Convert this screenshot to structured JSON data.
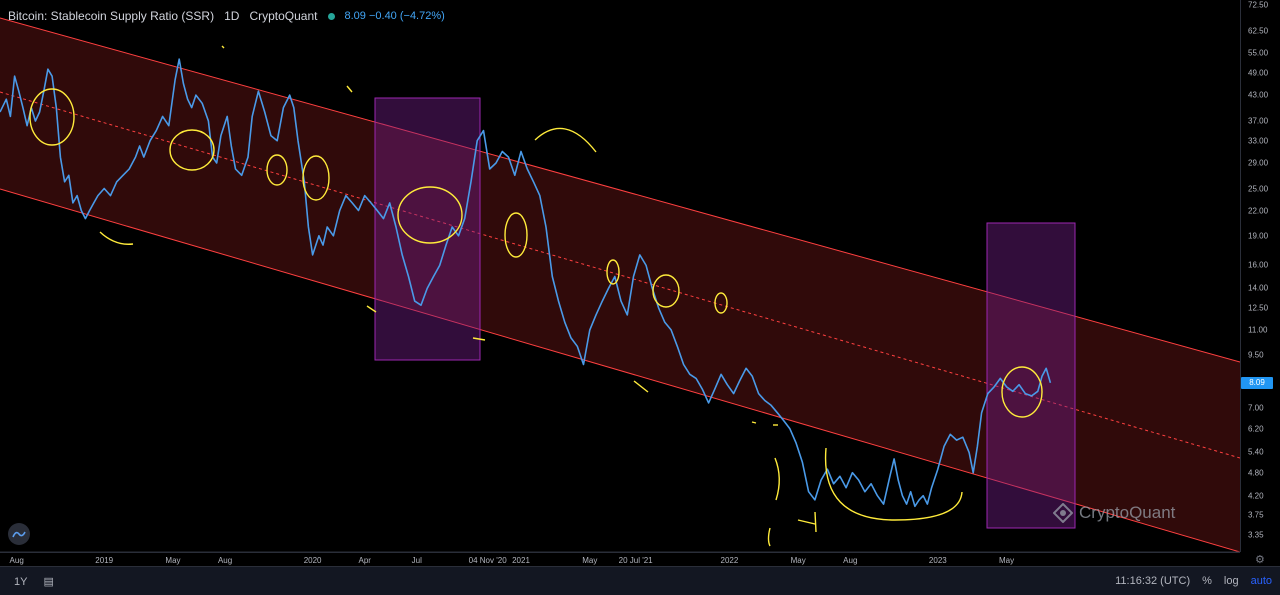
{
  "header": {
    "title": "Bitcoin: Stablecoin Supply Ratio (SSR)",
    "interval": "1D",
    "source": "CryptoQuant",
    "value_text": "8.09 −0.40 (−4.72%)"
  },
  "watermark": "CryptoQuant",
  "bottombar": {
    "range": "1Y",
    "time": "11:16:32 (UTC)",
    "percent": "%",
    "log": "log",
    "auto": "auto"
  },
  "colors": {
    "line": "#4a9ae8",
    "channel": "#ff4444",
    "box": "#9c27b0",
    "annotation": "#ffeb3b",
    "badge": "#2196f3"
  },
  "chart_data": {
    "type": "line",
    "title": "Bitcoin: Stablecoin Supply Ratio (SSR)",
    "scale": "log",
    "ylim": [
      3.1,
      73
    ],
    "last_value": "8.09",
    "y_ticks": [
      "72.50",
      "62.50",
      "55.00",
      "49.00",
      "43.00",
      "37.00",
      "33.00",
      "29.00",
      "25.00",
      "22.00",
      "19.00",
      "16.00",
      "14.00",
      "12.50",
      "11.00",
      "9.50",
      "7.00",
      "6.20",
      "5.40",
      "4.80",
      "4.20",
      "3.75",
      "3.35"
    ],
    "x_ticks": [
      {
        "label": "Aug",
        "t": 2018.58
      },
      {
        "label": "2019",
        "t": 2019.0
      },
      {
        "label": "May",
        "t": 2019.33
      },
      {
        "label": "Aug",
        "t": 2019.58
      },
      {
        "label": "2020",
        "t": 2020.0
      },
      {
        "label": "Apr",
        "t": 2020.25
      },
      {
        "label": "Jul",
        "t": 2020.5
      },
      {
        "label": "04 Nov '20",
        "t": 2020.84
      },
      {
        "label": "2021",
        "t": 2021.0
      },
      {
        "label": "May",
        "t": 2021.33
      },
      {
        "label": "20 Jul '21",
        "t": 2021.55
      },
      {
        "label": "2022",
        "t": 2022.0
      },
      {
        "label": "May",
        "t": 2022.33
      },
      {
        "label": "Aug",
        "t": 2022.58
      },
      {
        "label": "2023",
        "t": 2023.0
      },
      {
        "label": "May",
        "t": 2023.33
      }
    ],
    "x_range": [
      2018.5,
      2024.45
    ],
    "series": [
      {
        "points": [
          [
            2018.5,
            39
          ],
          [
            2018.53,
            42
          ],
          [
            2018.55,
            38
          ],
          [
            2018.57,
            48
          ],
          [
            2018.59,
            44
          ],
          [
            2018.61,
            40
          ],
          [
            2018.63,
            36
          ],
          [
            2018.65,
            40
          ],
          [
            2018.67,
            37
          ],
          [
            2018.69,
            39
          ],
          [
            2018.71,
            44
          ],
          [
            2018.73,
            50
          ],
          [
            2018.75,
            48
          ],
          [
            2018.77,
            40
          ],
          [
            2018.79,
            30
          ],
          [
            2018.81,
            26
          ],
          [
            2018.83,
            27
          ],
          [
            2018.85,
            23
          ],
          [
            2018.87,
            24
          ],
          [
            2018.89,
            22
          ],
          [
            2018.91,
            21
          ],
          [
            2018.93,
            22
          ],
          [
            2018.95,
            23
          ],
          [
            2018.97,
            24
          ],
          [
            2019.0,
            25
          ],
          [
            2019.03,
            24
          ],
          [
            2019.06,
            26
          ],
          [
            2019.09,
            27
          ],
          [
            2019.12,
            28
          ],
          [
            2019.15,
            30
          ],
          [
            2019.17,
            32
          ],
          [
            2019.19,
            30
          ],
          [
            2019.22,
            33
          ],
          [
            2019.25,
            35
          ],
          [
            2019.28,
            38
          ],
          [
            2019.31,
            36
          ],
          [
            2019.34,
            47
          ],
          [
            2019.36,
            53
          ],
          [
            2019.38,
            46
          ],
          [
            2019.4,
            42
          ],
          [
            2019.42,
            40
          ],
          [
            2019.44,
            43
          ],
          [
            2019.47,
            41
          ],
          [
            2019.5,
            37
          ],
          [
            2019.52,
            30
          ],
          [
            2019.54,
            29
          ],
          [
            2019.56,
            34
          ],
          [
            2019.59,
            38
          ],
          [
            2019.61,
            32
          ],
          [
            2019.63,
            28
          ],
          [
            2019.66,
            27
          ],
          [
            2019.69,
            30
          ],
          [
            2019.71,
            38
          ],
          [
            2019.74,
            44
          ],
          [
            2019.77,
            39
          ],
          [
            2019.8,
            34
          ],
          [
            2019.83,
            33
          ],
          [
            2019.86,
            40
          ],
          [
            2019.89,
            43
          ],
          [
            2019.91,
            40
          ],
          [
            2019.93,
            33
          ],
          [
            2019.96,
            26
          ],
          [
            2019.98,
            20
          ],
          [
            2020.0,
            17
          ],
          [
            2020.03,
            19
          ],
          [
            2020.05,
            18
          ],
          [
            2020.07,
            20
          ],
          [
            2020.1,
            19
          ],
          [
            2020.13,
            22
          ],
          [
            2020.16,
            24
          ],
          [
            2020.19,
            23
          ],
          [
            2020.22,
            22
          ],
          [
            2020.25,
            24
          ],
          [
            2020.28,
            23
          ],
          [
            2020.31,
            22
          ],
          [
            2020.34,
            21
          ],
          [
            2020.37,
            23
          ],
          [
            2020.4,
            20
          ],
          [
            2020.43,
            17
          ],
          [
            2020.46,
            15
          ],
          [
            2020.49,
            13
          ],
          [
            2020.52,
            12.7
          ],
          [
            2020.55,
            14
          ],
          [
            2020.58,
            15
          ],
          [
            2020.61,
            16
          ],
          [
            2020.64,
            18
          ],
          [
            2020.67,
            20
          ],
          [
            2020.7,
            19
          ],
          [
            2020.73,
            21
          ],
          [
            2020.76,
            26
          ],
          [
            2020.79,
            33
          ],
          [
            2020.82,
            35
          ],
          [
            2020.85,
            28
          ],
          [
            2020.88,
            29
          ],
          [
            2020.91,
            31
          ],
          [
            2020.94,
            30
          ],
          [
            2020.97,
            27
          ],
          [
            2021.0,
            31
          ],
          [
            2021.03,
            28
          ],
          [
            2021.06,
            26
          ],
          [
            2021.09,
            24
          ],
          [
            2021.12,
            20
          ],
          [
            2021.15,
            15
          ],
          [
            2021.18,
            13
          ],
          [
            2021.21,
            11.5
          ],
          [
            2021.24,
            10.5
          ],
          [
            2021.27,
            10
          ],
          [
            2021.3,
            9
          ],
          [
            2021.33,
            11
          ],
          [
            2021.36,
            12
          ],
          [
            2021.39,
            13
          ],
          [
            2021.42,
            14
          ],
          [
            2021.45,
            15
          ],
          [
            2021.48,
            13
          ],
          [
            2021.51,
            12
          ],
          [
            2021.54,
            15
          ],
          [
            2021.57,
            17
          ],
          [
            2021.6,
            16
          ],
          [
            2021.63,
            14
          ],
          [
            2021.66,
            12.5
          ],
          [
            2021.69,
            11.5
          ],
          [
            2021.72,
            11
          ],
          [
            2021.75,
            10
          ],
          [
            2021.78,
            9
          ],
          [
            2021.81,
            8.5
          ],
          [
            2021.84,
            8.3
          ],
          [
            2021.87,
            7.8
          ],
          [
            2021.9,
            7.2
          ],
          [
            2021.93,
            7.8
          ],
          [
            2021.96,
            8.5
          ],
          [
            2021.99,
            8.0
          ],
          [
            2022.02,
            7.6
          ],
          [
            2022.05,
            8.2
          ],
          [
            2022.08,
            8.8
          ],
          [
            2022.11,
            8.4
          ],
          [
            2022.14,
            7.6
          ],
          [
            2022.17,
            7.3
          ],
          [
            2022.2,
            7.1
          ],
          [
            2022.23,
            6.8
          ],
          [
            2022.26,
            6.5
          ],
          [
            2022.29,
            6.2
          ],
          [
            2022.32,
            5.7
          ],
          [
            2022.35,
            5.1
          ],
          [
            2022.38,
            4.3
          ],
          [
            2022.41,
            4.1
          ],
          [
            2022.44,
            4.6
          ],
          [
            2022.47,
            4.9
          ],
          [
            2022.5,
            4.5
          ],
          [
            2022.53,
            4.7
          ],
          [
            2022.56,
            4.4
          ],
          [
            2022.59,
            4.8
          ],
          [
            2022.62,
            4.6
          ],
          [
            2022.65,
            4.3
          ],
          [
            2022.68,
            4.5
          ],
          [
            2022.71,
            4.2
          ],
          [
            2022.74,
            4.0
          ],
          [
            2022.77,
            4.7
          ],
          [
            2022.79,
            5.2
          ],
          [
            2022.81,
            4.6
          ],
          [
            2022.83,
            4.2
          ],
          [
            2022.85,
            4.0
          ],
          [
            2022.87,
            4.3
          ],
          [
            2022.89,
            3.95
          ],
          [
            2022.91,
            4.1
          ],
          [
            2022.93,
            4.2
          ],
          [
            2022.95,
            4.0
          ],
          [
            2022.97,
            4.4
          ],
          [
            2023.0,
            4.9
          ],
          [
            2023.03,
            5.6
          ],
          [
            2023.06,
            6.0
          ],
          [
            2023.09,
            5.8
          ],
          [
            2023.12,
            5.9
          ],
          [
            2023.15,
            5.4
          ],
          [
            2023.17,
            4.8
          ],
          [
            2023.19,
            5.6
          ],
          [
            2023.21,
            6.8
          ],
          [
            2023.24,
            7.6
          ],
          [
            2023.27,
            7.9
          ],
          [
            2023.3,
            8.3
          ],
          [
            2023.33,
            7.9
          ],
          [
            2023.36,
            7.7
          ],
          [
            2023.39,
            8.0
          ],
          [
            2023.42,
            7.6
          ],
          [
            2023.45,
            7.5
          ],
          [
            2023.48,
            7.7
          ],
          [
            2023.5,
            8.4
          ],
          [
            2023.52,
            8.8
          ],
          [
            2023.54,
            8.09
          ]
        ]
      }
    ]
  }
}
